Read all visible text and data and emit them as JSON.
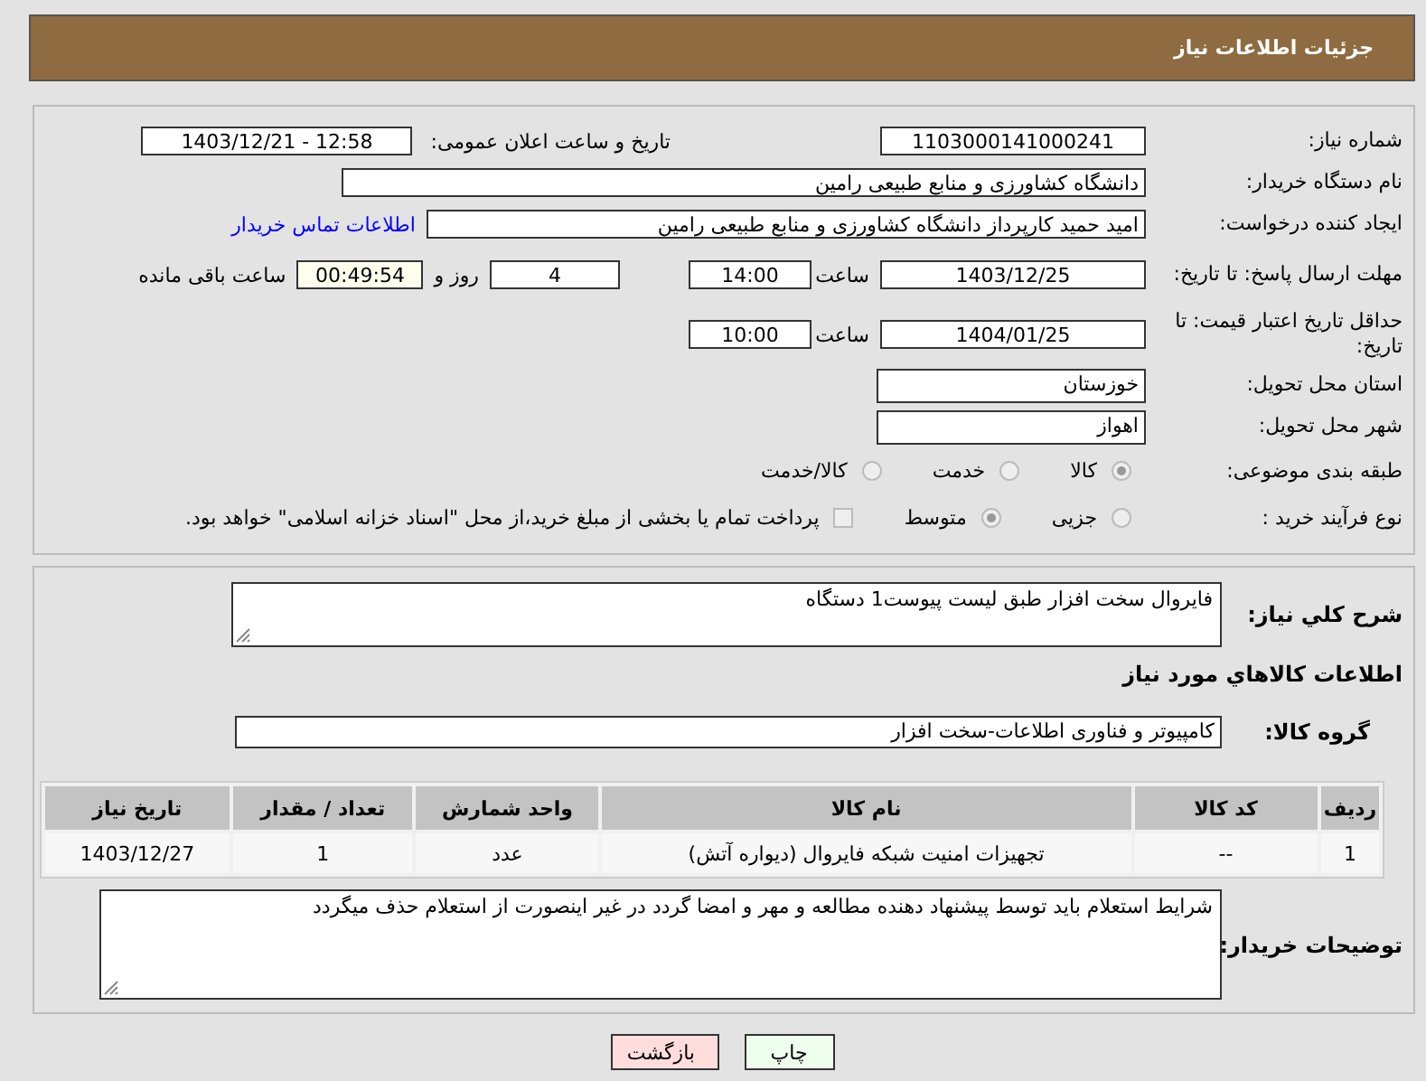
{
  "header": {
    "title": "جزئیات اطلاعات نیاز"
  },
  "need_number": {
    "label": "شماره نیاز:",
    "value": "1103000141000241"
  },
  "announce": {
    "label": "تاریخ و ساعت اعلان عمومی:",
    "value": "1403/12/21 - 12:58"
  },
  "buyer_org": {
    "label": "نام دستگاه خریدار:",
    "value": "دانشگاه کشاورزی و منابع طبیعی رامین"
  },
  "requester": {
    "label": "ایجاد کننده درخواست:",
    "value": "امید حمید کارپرداز دانشگاه کشاورزی و منابع طبیعی رامین",
    "link": "اطلاعات تماس خریدار"
  },
  "reply_deadline": {
    "label": "مهلت ارسال پاسخ: تا تاریخ:",
    "date": "1403/12/25",
    "time_label": "ساعت",
    "time": "14:00",
    "days": "4",
    "days_label": "روز و",
    "remaining": "00:49:54",
    "remaining_label": "ساعت باقی مانده"
  },
  "price_validity": {
    "label": "حداقل تاریخ اعتبار قیمت: تا تاریخ:",
    "date": "1404/01/25",
    "time_label": "ساعت",
    "time": "10:00"
  },
  "province": {
    "label": "استان محل تحویل:",
    "value": "خوزستان"
  },
  "city": {
    "label": "شهر محل تحویل:",
    "value": "اهواز"
  },
  "category": {
    "label": "طبقه بندی موضوعی:",
    "options": [
      {
        "label": "کالا",
        "selected": true
      },
      {
        "label": "خدمت",
        "selected": false
      },
      {
        "label": "کالا/خدمت",
        "selected": false
      }
    ]
  },
  "purchase_type": {
    "label": "نوع فرآیند خرید :",
    "options": [
      {
        "label": "جزیی",
        "selected": false
      },
      {
        "label": "متوسط",
        "selected": true
      }
    ],
    "payment": {
      "label": "پرداخت تمام یا بخشی از مبلغ خرید،از محل \"اسناد خزانه اسلامی\" خواهد بود.",
      "checked": false
    }
  },
  "description": {
    "label": "شرح کلي نیاز:",
    "value": "فایروال سخت افزار طبق لیست پیوست1 دستگاه"
  },
  "goods_heading": "اطلاعات کالاهاي مورد نیاز",
  "goods_group": {
    "label": "گروه کالا:",
    "value": "کامپیوتر و فناوری اطلاعات-سخت افزار"
  },
  "table": {
    "columns": [
      "ردیف",
      "کد کالا",
      "نام کالا",
      "واحد شمارش",
      "تعداد / مقدار",
      "تاریخ نیاز"
    ],
    "rows": [
      [
        "1",
        "--",
        "تجهیزات امنیت شبکه فایروال (دیواره آتش)",
        "عدد",
        "1",
        "1403/12/27"
      ]
    ]
  },
  "buyer_notes": {
    "label": "توضیحات خریدار:",
    "value": "شرایط استعلام باید توسط پیشنهاد دهنده مطالعه و مهر و امضا گردد در غیر اینصورت از استعلام حذف میگردد"
  },
  "buttons": [
    {
      "label": "چاپ",
      "kind": "print"
    },
    {
      "label": "بازگشت",
      "kind": "back"
    }
  ]
}
